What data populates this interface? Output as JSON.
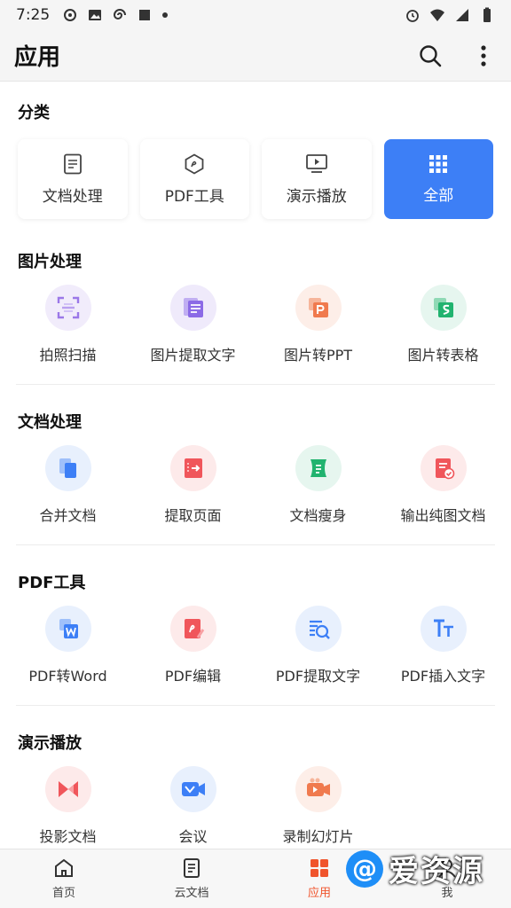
{
  "status_bar": {
    "time": "7:25"
  },
  "app_bar": {
    "title": "应用"
  },
  "categories": {
    "title": "分类",
    "items": [
      {
        "label": "文档处理",
        "icon": "document-icon"
      },
      {
        "label": "PDF工具",
        "icon": "pdf-hex-icon"
      },
      {
        "label": "演示播放",
        "icon": "presentation-play-icon"
      },
      {
        "label": "全部",
        "icon": "grid-dots-icon",
        "active": true
      }
    ]
  },
  "sections": [
    {
      "title": "图片处理",
      "items": [
        {
          "label": "拍照扫描",
          "icon": "scan-icon",
          "bg": "#f1ecfb",
          "color": "#9b78e8"
        },
        {
          "label": "图片提取文字",
          "icon": "image-text-icon",
          "bg": "#efeafb",
          "color": "#8b6ae6"
        },
        {
          "label": "图片转PPT",
          "icon": "image-ppt-icon",
          "bg": "#fdeee8",
          "color": "#f07a4e"
        },
        {
          "label": "图片转表格",
          "icon": "image-sheet-icon",
          "bg": "#e6f6ef",
          "color": "#21b36f"
        }
      ]
    },
    {
      "title": "文档处理",
      "items": [
        {
          "label": "合并文档",
          "icon": "merge-docs-icon",
          "bg": "#e8f0fd",
          "color": "#3d7ff6"
        },
        {
          "label": "提取页面",
          "icon": "extract-page-icon",
          "bg": "#fdeaea",
          "color": "#f0565b"
        },
        {
          "label": "文档瘦身",
          "icon": "compress-doc-icon",
          "bg": "#e6f6ef",
          "color": "#21b36f"
        },
        {
          "label": "输出纯图文档",
          "icon": "image-doc-icon",
          "bg": "#fdeaea",
          "color": "#f0565b"
        }
      ]
    },
    {
      "title": "PDF工具",
      "items": [
        {
          "label": "PDF转Word",
          "icon": "pdf-word-icon",
          "bg": "#e8f0fd",
          "color": "#3d7ff6"
        },
        {
          "label": "PDF编辑",
          "icon": "pdf-edit-icon",
          "bg": "#fdeaea",
          "color": "#f0565b"
        },
        {
          "label": "PDF提取文字",
          "icon": "pdf-text-icon",
          "bg": "#e8f0fd",
          "color": "#3d7ff6"
        },
        {
          "label": "PDF插入文字",
          "icon": "insert-text-icon",
          "bg": "#e8f0fd",
          "color": "#3d7ff6"
        }
      ]
    },
    {
      "title": "演示播放",
      "items": [
        {
          "label": "投影文档",
          "icon": "projection-icon",
          "bg": "#fdeaea",
          "color": "#f0565b"
        },
        {
          "label": "会议",
          "icon": "meeting-video-icon",
          "bg": "#e8f0fd",
          "color": "#3d7ff6"
        },
        {
          "label": "录制幻灯片",
          "icon": "record-slides-icon",
          "bg": "#fdeee8",
          "color": "#f07a4e"
        }
      ]
    }
  ],
  "bottom_nav": [
    {
      "label": "首页",
      "icon": "home-icon"
    },
    {
      "label": "云文档",
      "icon": "cloud-doc-icon"
    },
    {
      "label": "应用",
      "icon": "apps-icon",
      "active": true
    },
    {
      "label": "我",
      "icon": "user-icon"
    }
  ],
  "watermark": {
    "text": "爱资源"
  }
}
